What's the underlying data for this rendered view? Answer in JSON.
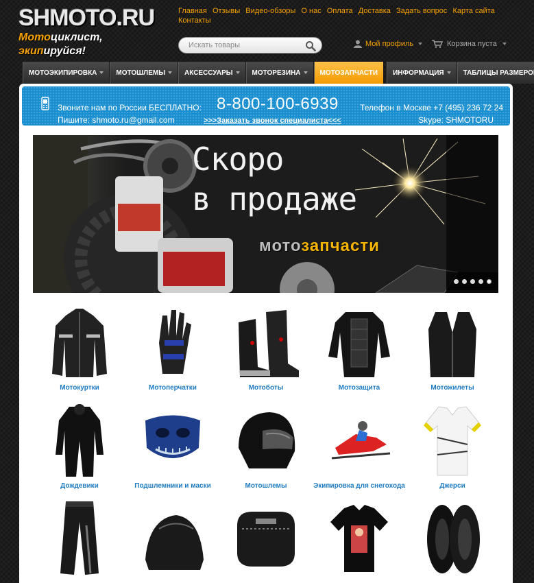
{
  "logo": {
    "main": "SHMOTO.RU",
    "sub_hl1": "Мото",
    "sub_mid": "циклист, ",
    "sub_hl2": "экип",
    "sub_end": "ируйся!"
  },
  "top_links": [
    "Главная",
    "Отзывы",
    "Видео-обзоры",
    "О нас",
    "Оплата",
    "Доставка",
    "Задать вопрос",
    "Карта сайта",
    "Контакты"
  ],
  "search": {
    "placeholder": "Искать товары"
  },
  "profile": {
    "label": "Мой профиль"
  },
  "cart": {
    "label": "Корзина пуста"
  },
  "nav": [
    {
      "label": "МОТОЭКИПИРОВКА",
      "has_caret": true,
      "active": false
    },
    {
      "label": "МОТОШЛЕМЫ",
      "has_caret": true,
      "active": false
    },
    {
      "label": "АКСЕССУАРЫ",
      "has_caret": true,
      "active": false
    },
    {
      "label": "МОТОРЕЗИНА",
      "has_caret": true,
      "active": false
    },
    {
      "label": "МОТОЗАПЧАСТИ",
      "has_caret": false,
      "active": true
    },
    {
      "label": "ИНФОРМАЦИЯ",
      "has_caret": true,
      "active": false
    },
    {
      "label": "ТАБЛИЦЫ РАЗМЕРОВ",
      "has_caret": true,
      "active": false
    }
  ],
  "phone_bar": {
    "call_text": "Звоните нам по России БЕСПЛАТНО:",
    "phone": "8-800-100-6939",
    "moscow": "Телефон в Москве +7 (495) 236 72 24",
    "mail": "Пишите: shmoto.ru@gmail.com",
    "order": ">>>Заказать звонок специалиста<<<",
    "skype": "Skype: SHMOTORU"
  },
  "banner": {
    "title_line1": "Скоро",
    "title_line2": "в продаже",
    "sub_a": "мото",
    "sub_b": "запчасти",
    "dots": 5,
    "active_dot": 4
  },
  "categories": [
    {
      "label": "Мотокуртки",
      "icon": "jacket"
    },
    {
      "label": "Мотоперчатки",
      "icon": "glove"
    },
    {
      "label": "Мотоботы",
      "icon": "boots"
    },
    {
      "label": "Мотозащита",
      "icon": "armor"
    },
    {
      "label": "Мотожилеты",
      "icon": "vest"
    },
    {
      "label": "Дождевики",
      "icon": "raincoat"
    },
    {
      "label": "Подшлемники и маски",
      "icon": "mask"
    },
    {
      "label": "Мотошлемы",
      "icon": "helmet"
    },
    {
      "label": "Экипировка для снегохода",
      "icon": "snowmobile"
    },
    {
      "label": "Джерси",
      "icon": "jersey"
    },
    {
      "label": "",
      "icon": "pants"
    },
    {
      "label": "",
      "icon": "cover"
    },
    {
      "label": "",
      "icon": "bag"
    },
    {
      "label": "",
      "icon": "tshirt"
    },
    {
      "label": "",
      "icon": "tires"
    }
  ],
  "colors": {
    "accent": "#f7a200",
    "blue": "#1a8fd0",
    "link": "#1f7bc0"
  }
}
